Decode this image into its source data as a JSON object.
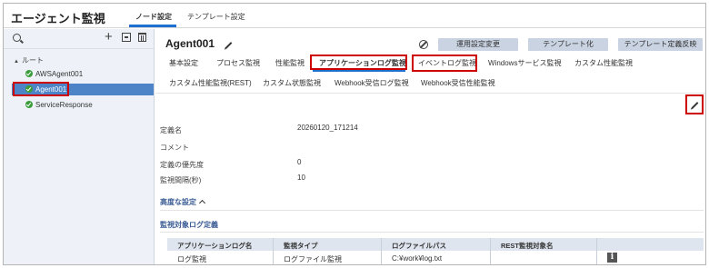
{
  "app": {
    "title": "エージェント監視"
  },
  "top_tabs": [
    {
      "label": "ノード設定",
      "active": true
    },
    {
      "label": "テンプレート設定",
      "active": false
    }
  ],
  "sidebar": {
    "icons": [
      "search-icon",
      "plus-icon",
      "import-icon",
      "trash-icon"
    ],
    "tree_root": "ルート",
    "items": [
      {
        "label": "AWSAgent001",
        "status": "ok",
        "selected": false
      },
      {
        "label": "Agent001",
        "status": "ok",
        "selected": true
      },
      {
        "label": "ServiceResponse",
        "status": "ok",
        "selected": false
      }
    ]
  },
  "main": {
    "title": "Agent001",
    "buttons": {
      "apply": "運用設定変更",
      "templatize": "テンプレート化",
      "reflect": "テンプレート定義反映"
    },
    "tabs_row1": [
      "基本設定",
      "プロセス監視",
      "性能監視",
      "アプリケーションログ監視",
      "イベントログ監視",
      "Windowsサービス監視",
      "カスタム性能監視"
    ],
    "tabs_row2": [
      "カスタム性能監視(REST)",
      "カスタム状態監視",
      "Webhook受信ログ監視",
      "Webhook受信性能監視"
    ],
    "active_tab": "アプリケーションログ監視",
    "fields": {
      "def_name_label": "定義名",
      "def_name_value": "20260120_171214",
      "comment_label": "コメント",
      "priority_label": "定義の優先度",
      "priority_value": "0",
      "interval_label": "監視間隔(秒)",
      "interval_value": "10"
    },
    "advanced_label": "高度な設定",
    "section_title": "監視対象ログ定義",
    "table": {
      "headers": [
        "アプリケーションログ名",
        "監視タイプ",
        "ログファイルパス",
        "REST監視対象名"
      ],
      "rows": [
        [
          "ログ監視",
          "ログファイル監視",
          "C:¥work¥log.txt",
          ""
        ]
      ]
    }
  },
  "colors": {
    "accent": "#1f6fd1",
    "selected": "#4d84c8",
    "highlight": "#cc0000",
    "ok": "#3a9d3a",
    "button": "#c9d3e2"
  }
}
